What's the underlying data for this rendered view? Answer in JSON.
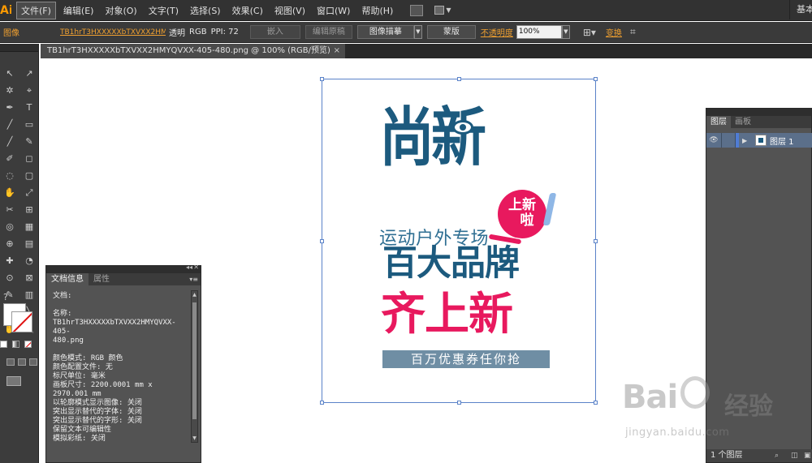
{
  "menubar": {
    "logo": "Ai",
    "items": [
      "文件(F)",
      "编辑(E)",
      "对象(O)",
      "文字(T)",
      "选择(S)",
      "效果(C)",
      "视图(V)",
      "窗口(W)",
      "帮助(H)"
    ],
    "workspace": "基本功"
  },
  "controlbar": {
    "object_type": "图像",
    "file_name": "TB1hrT3HXXXXXbTXVXX2HM...",
    "transparency": "透明",
    "color_mode": "RGB",
    "ppi": "PPI: 72",
    "embed_button": "嵌入",
    "edit_original_button": "编辑原稿",
    "image_trace_button": "图像描摹",
    "mask_button": "蒙版",
    "opacity_label": "不透明度",
    "opacity_value": "100%",
    "transform_label": "变换"
  },
  "tab": {
    "title": "TB1hrT3HXXXXXbTXVXX2HMYQVXX-405-480.png @ 100% (RGB/预览)",
    "close": "×"
  },
  "tools": [
    "↖",
    "↗",
    "✲",
    "⌖",
    "✒",
    "T",
    "╱",
    "▭",
    "╱",
    "✎",
    "✐",
    "◻",
    "◌",
    "▢",
    "✋",
    "⤢",
    "✂",
    "⊞",
    "◎",
    "▦",
    "⊕",
    "▤",
    "✚",
    "◔",
    "⊙",
    "⊠",
    "✎",
    "▥",
    "▯",
    "╲",
    "✋",
    "🔍"
  ],
  "docinfo": {
    "tabs": [
      "文档信息",
      "属性"
    ],
    "lines": [
      "文档:",
      "",
      "名称:",
      "TB1hrT3HXXXXXbTXVXX2HMYQVXX-405-",
      "480.png",
      "",
      "颜色模式: RGB 颜色",
      "颜色配置文件: 无",
      "标尺单位: 毫米",
      "画板尺寸: 2200.0001 mm x",
      "2970.001 mm",
      "以轮廓模式显示图像: 关闭",
      "突出显示替代的字体: 关闭",
      "突出显示替代的字形: 关闭",
      "保留文本可编辑性",
      "模拟彩纸: 关闭"
    ]
  },
  "artwork": {
    "brand": "尚新",
    "badge_line1": "上新",
    "badge_line2": "啦",
    "subtitle": "运动户外专场",
    "headline1": "百大品牌",
    "headline2": "齐上新",
    "banner": "百万优惠券任你抢",
    "colors": {
      "navy": "#1c5a7e",
      "pink": "#e8195e",
      "banner": "#6f8ea4"
    }
  },
  "layers": {
    "tabs": [
      "图层",
      "画板"
    ],
    "layer_name": "图层 1",
    "footer": "1 个图层"
  },
  "watermark": {
    "text_left": "Bai",
    "text_right": "经验",
    "url": "jingyan.baidu.com"
  }
}
